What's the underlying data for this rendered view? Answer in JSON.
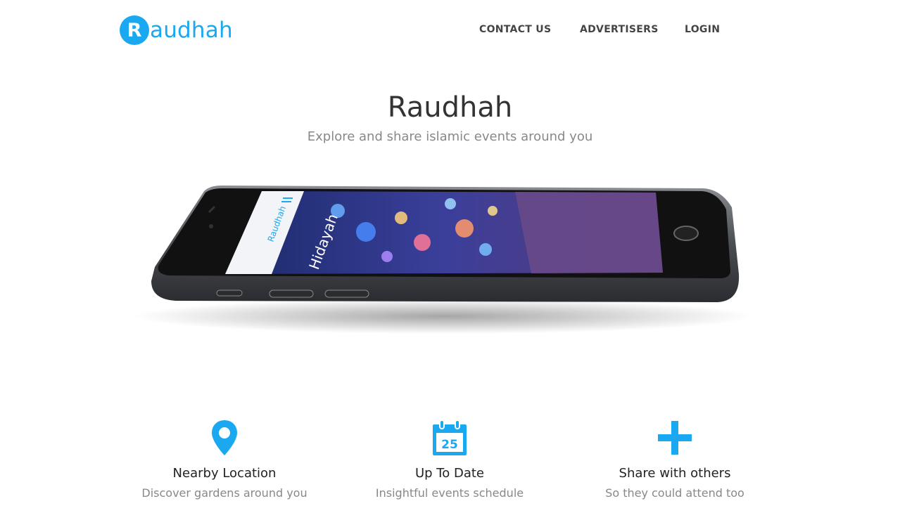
{
  "brand": {
    "badge_letter": "R",
    "name_rest": "audhah",
    "color": "#1aa8f0"
  },
  "nav": [
    {
      "label": "CONTACT US"
    },
    {
      "label": "ADVERTISERS"
    },
    {
      "label": "LOGIN"
    }
  ],
  "hero": {
    "title": "Raudhah",
    "subtitle": "Explore and share islamic events around you"
  },
  "phone_screen": {
    "app_name": "Raudhah",
    "feature_text": "Hidayah"
  },
  "features": [
    {
      "icon": "map-pin-icon",
      "title": "Nearby Location",
      "desc": "Discover gardens around you"
    },
    {
      "icon": "calendar-icon",
      "calendar_day": "25",
      "title": "Up To Date",
      "desc": "Insightful events schedule"
    },
    {
      "icon": "plus-icon",
      "title": "Share with others",
      "desc": "So they could attend too"
    }
  ],
  "colors": {
    "accent": "#1aa8f0",
    "text": "#333333",
    "muted": "#888888"
  }
}
